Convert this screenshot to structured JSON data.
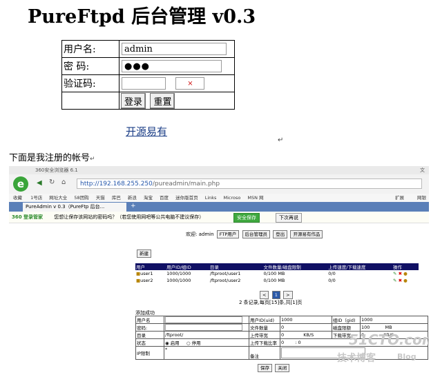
{
  "title": "PureFtpd 后台管理  v0.3",
  "login": {
    "username_label": "用户名:",
    "username_value": "admin",
    "password_label": "密    码:",
    "password_value": "●●●",
    "captcha_label": "验证码:",
    "captcha_image": "×",
    "login_button": "登录",
    "reset_button": "重置"
  },
  "opensource_link": "开源易有",
  "caption": "下面是我注册的帐号",
  "shot": {
    "browser_name": "360安全浏览器 6.1",
    "topbar_right": "文",
    "url_host": "http://192.168.255.250",
    "url_path": "/pureadmin/main.php",
    "favorites": [
      "收藏",
      "1号店",
      "网址大全",
      "58团购",
      "天猫",
      "库巴",
      "新浪",
      "淘宝",
      "百度",
      "迷你版首页",
      "Links",
      "Microso",
      "MSN 网"
    ],
    "fav_right": [
      "扩展",
      "网银"
    ],
    "tab_label": "PureAdmin v 0.3（PureFtp 后台...",
    "pw_brand": "360 登录管家",
    "pw_prompt": "您想让保存该网站的密码吗？（若您使用网吧等公共电脑不建议保存）",
    "pw_save": "安全保存",
    "pw_later": "下次再说",
    "welcome": "欢迎: admin",
    "nav": [
      "FTP用户",
      "后台管理员",
      "登出",
      "开源易有作品"
    ],
    "new_button": "新建",
    "user_headers": [
      "用户",
      "用户ID/组ID",
      "目录",
      "文件数量/磁盘限制",
      "上传速度/下载速度",
      "操作"
    ],
    "users": [
      {
        "name": "user1",
        "ids": "1000/1000",
        "dir": "/ftproot/user1",
        "quota": "0/100 MB",
        "speed": "0/0"
      },
      {
        "name": "user2",
        "ids": "1000/1000",
        "dir": "/ftproot/user2",
        "quota": "0/100 MB",
        "speed": "0/0"
      }
    ],
    "pager": {
      "prev": "<",
      "page": "1",
      "next": ">"
    },
    "records": "2 条记录,每页[15]条,共[1]页",
    "add_success": "添加成功",
    "form": {
      "username": "用户名",
      "password": "密码:",
      "dir_label": "目录",
      "dir_value": "/ftproot/",
      "status_label": "状态",
      "status_on": "启用",
      "status_off": "停用",
      "ip_label": "IP限制",
      "ip_value": "*",
      "uid_label": "用户ID(uid)",
      "uid_value": "1000",
      "gid_label": "组ID（gid)",
      "gid_value": "1000",
      "filecount_label": "文件数量",
      "filecount_value": "0",
      "quota_label": "磁盘限额",
      "quota_value": "100",
      "quota_unit": "MB",
      "up_label": "上传带宽",
      "up_value": "0",
      "up_unit": "KB/S",
      "down_label": "下载带宽",
      "down_value": "0",
      "down_unit": "KB/S",
      "ratio_label": "上传下载比率",
      "ratio_value_a": "0",
      "ratio_sep": ":",
      "ratio_value_b": "0",
      "note_label": "备注",
      "save_button": "保存",
      "close_button": "关闭"
    },
    "watermark_1": "51CTO.com",
    "watermark_2": "技术博客",
    "watermark_3": "Blog"
  }
}
